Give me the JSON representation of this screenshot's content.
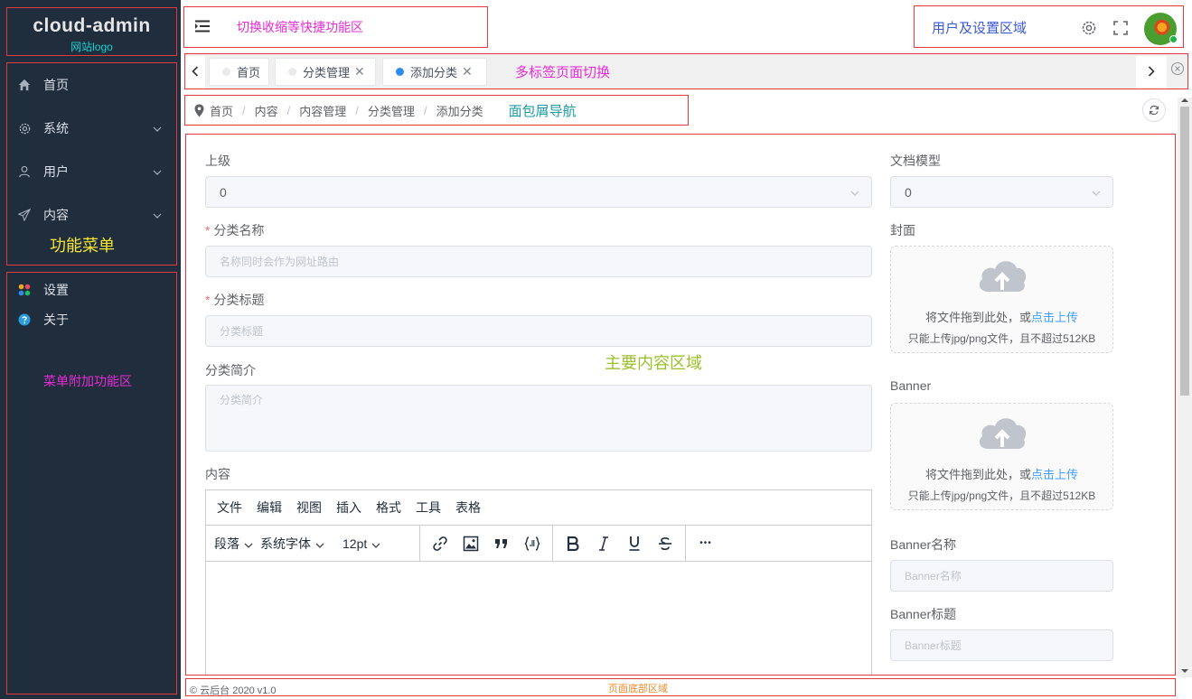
{
  "sidebar": {
    "logo_title": "cloud-admin",
    "logo_sub": "网站logo",
    "menu_caption": "功能菜单",
    "items": [
      {
        "label": "首页",
        "icon": "home-icon"
      },
      {
        "label": "系统",
        "icon": "gear-icon"
      },
      {
        "label": "用户",
        "icon": "user-icon"
      },
      {
        "label": "内容",
        "icon": "send-icon"
      }
    ],
    "extra": [
      {
        "label": "设置",
        "icon": "colorful-dots-icon"
      },
      {
        "label": "关于",
        "icon": "help-icon"
      }
    ],
    "extra_caption": "菜单附加功能区"
  },
  "topbar": {
    "shortcut_caption": "切换收缩等快捷功能区",
    "user_caption": "用户及设置区域"
  },
  "tabs": {
    "items": [
      {
        "label": "首页",
        "closable": false,
        "active": false
      },
      {
        "label": "分类管理",
        "closable": true,
        "active": false
      },
      {
        "label": "添加分类",
        "closable": true,
        "active": true
      }
    ],
    "close_glyph": "✕",
    "caption": "多标签页面切换"
  },
  "breadcrumb": {
    "items": [
      "首页",
      "内容",
      "内容管理",
      "分类管理",
      "添加分类"
    ],
    "separator": "/",
    "caption": "面包屑导航"
  },
  "form": {
    "parent_label": "上级",
    "parent_value": "0",
    "name_label": "分类名称",
    "name_placeholder": "名称同时会作为网址路由",
    "title_label": "分类标题",
    "title_placeholder": "分类标题",
    "intro_label": "分类简介",
    "intro_placeholder": "分类简介",
    "content_label": "内容",
    "model_label": "文档模型",
    "model_value": "0",
    "cover_label": "封面",
    "banner_label": "Banner",
    "upload_text": "将文件拖到此处，或",
    "upload_link": "点击上传",
    "upload_tip": "只能上传jpg/png文件，且不超过512KB",
    "banner_name_label": "Banner名称",
    "banner_name_placeholder": "Banner名称",
    "banner_title_label": "Banner标题",
    "banner_title_placeholder": "Banner标题",
    "required_mark": "*"
  },
  "main_caption": "主要内容区域",
  "editor": {
    "menus": [
      "文件",
      "编辑",
      "视图",
      "插入",
      "格式",
      "工具",
      "表格"
    ],
    "block_format": "段落",
    "font_family": "系统字体",
    "font_size": "12pt",
    "more_glyph": "•••"
  },
  "footer": {
    "copyright": "© 云后台 2020 v1.0",
    "caption": "页面底部区域"
  },
  "colors": {
    "sidebar_bg": "#1f2d3d",
    "accent": "#409eff",
    "outline": "#e4393c"
  }
}
